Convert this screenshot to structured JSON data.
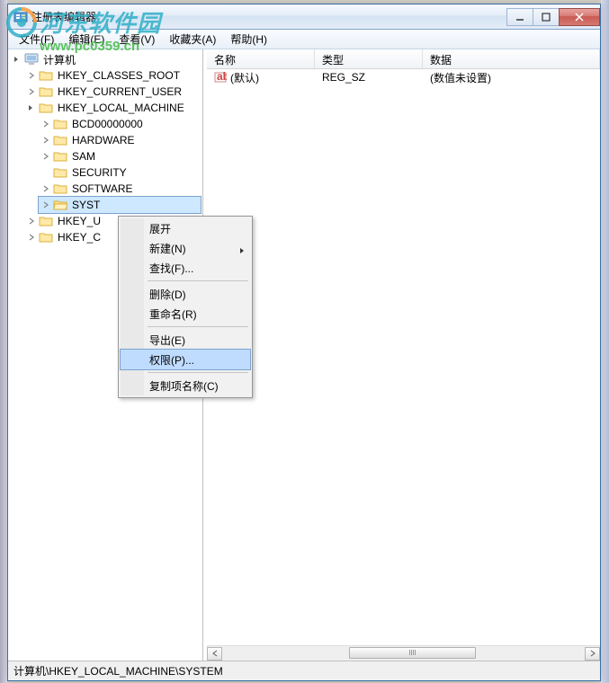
{
  "window": {
    "title": "注册表编辑器"
  },
  "menu": {
    "file": "文件(F)",
    "edit": "编辑(E)",
    "view": "查看(V)",
    "fav": "收藏夹(A)",
    "help": "帮助(H)"
  },
  "tree": {
    "root": "计算机",
    "hkcr": "HKEY_CLASSES_ROOT",
    "hkcu": "HKEY_CURRENT_USER",
    "hklm": "HKEY_LOCAL_MACHINE",
    "hklm_children": {
      "bcd": "BCD00000000",
      "hardware": "HARDWARE",
      "sam": "SAM",
      "security": "SECURITY",
      "software": "SOFTWARE",
      "system": "SYST"
    },
    "hku": "HKEY_U",
    "hkcc": "HKEY_C"
  },
  "columns": {
    "name": "名称",
    "type": "类型",
    "data": "数据"
  },
  "values": [
    {
      "name": "(默认)",
      "type": "REG_SZ",
      "data": "(数值未设置)"
    }
  ],
  "context": {
    "expand": "展开",
    "new": "新建(N)",
    "find": "查找(F)...",
    "delete": "删除(D)",
    "rename": "重命名(R)",
    "export": "导出(E)",
    "perm": "权限(P)...",
    "copykey": "复制项名称(C)"
  },
  "status": {
    "path": "计算机\\HKEY_LOCAL_MACHINE\\SYSTEM"
  },
  "watermark": {
    "text": "河东软件园",
    "url": "www.pc0359.cn"
  }
}
